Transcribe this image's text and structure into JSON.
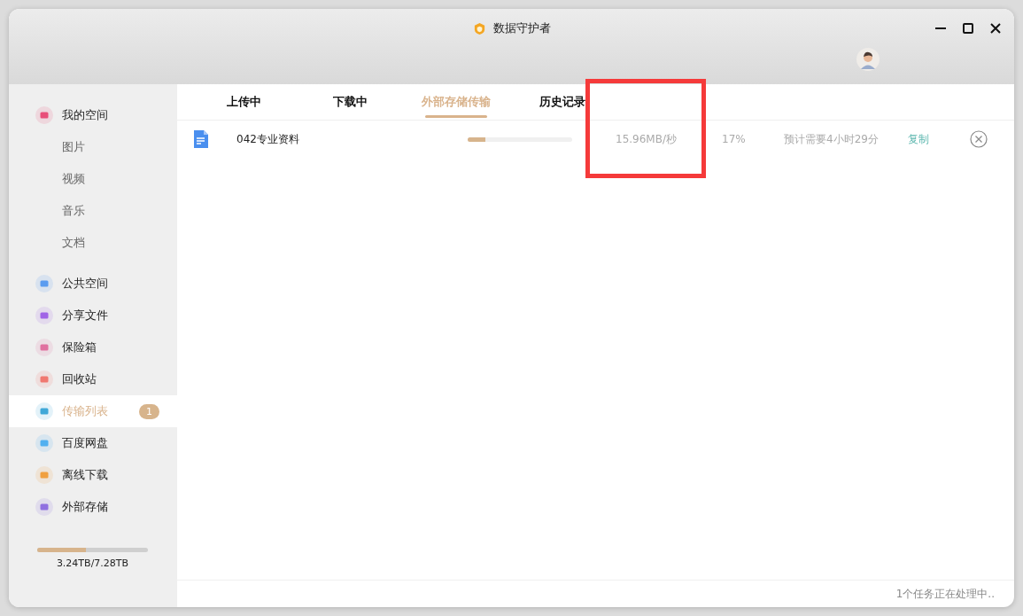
{
  "window": {
    "title": "数据守护者"
  },
  "sidebar": {
    "items": [
      {
        "label": "我的空间",
        "kind": "main",
        "color": "#e8507a",
        "selected": false
      },
      {
        "label": "图片",
        "kind": "sub",
        "selected": false
      },
      {
        "label": "视频",
        "kind": "sub",
        "selected": false
      },
      {
        "label": "音乐",
        "kind": "sub",
        "selected": false
      },
      {
        "label": "文档",
        "kind": "sub",
        "selected": false
      },
      {
        "label": "公共空间",
        "kind": "main",
        "color": "#5a9cf0",
        "selected": false
      },
      {
        "label": "分享文件",
        "kind": "main",
        "color": "#a064e6",
        "selected": false
      },
      {
        "label": "保险箱",
        "kind": "main",
        "color": "#e070a0",
        "selected": false
      },
      {
        "label": "回收站",
        "kind": "main",
        "color": "#f07870",
        "selected": false
      },
      {
        "label": "传输列表",
        "kind": "main",
        "color": "#40a8d8",
        "selected": true,
        "badge": "1"
      },
      {
        "label": "百度网盘",
        "kind": "main",
        "color": "#50b0f0",
        "selected": false
      },
      {
        "label": "离线下载",
        "kind": "main",
        "color": "#f0a040",
        "selected": false
      },
      {
        "label": "外部存储",
        "kind": "main",
        "color": "#9070e0",
        "selected": false
      }
    ],
    "storage": {
      "level": 0.44,
      "text": "3.24TB/7.28TB"
    }
  },
  "tabs": [
    {
      "label": "上传中",
      "selected": false
    },
    {
      "label": "下载中",
      "selected": false
    },
    {
      "label": "外部存储传输",
      "selected": true
    },
    {
      "label": "历史记录",
      "selected": false
    }
  ],
  "tasks": [
    {
      "name": "042专业资料",
      "level": 0.17,
      "speed": "15.96MB/秒",
      "percent": "17%",
      "eta": "预计需要4小时29分",
      "action": "复制"
    }
  ],
  "status_bar": "1个任务正在处理中.."
}
